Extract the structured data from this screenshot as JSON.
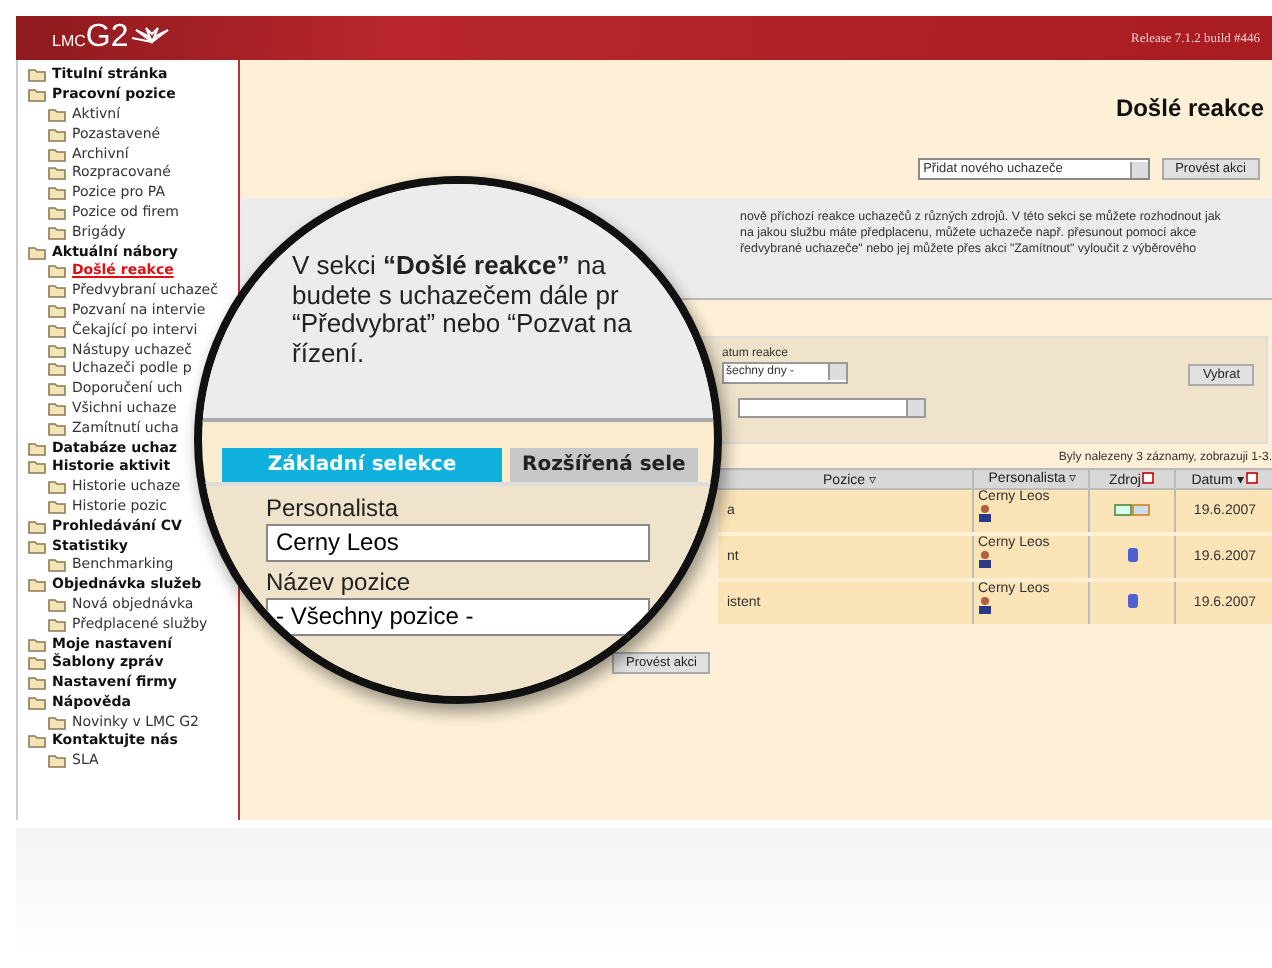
{
  "header": {
    "logo_small": "LMC",
    "logo_big": "G2",
    "release": "Release 7.1.2 build #446"
  },
  "sidebar": {
    "items": [
      {
        "label": "Titulní stránka",
        "selected": false
      },
      {
        "label": "Pracovní pozice",
        "selected": false,
        "children": [
          {
            "label": "Aktivní",
            "selected": false
          },
          {
            "label": "Pozastavené",
            "selected": false
          },
          {
            "label": "Archivní",
            "selected": false
          },
          {
            "label": "Rozpracované",
            "selected": false
          },
          {
            "label": "Pozice pro PA",
            "selected": false
          },
          {
            "label": "Pozice od firem",
            "selected": false
          },
          {
            "label": "Brigády",
            "selected": false
          }
        ]
      },
      {
        "label": "Aktuální nábory",
        "selected": false,
        "children": [
          {
            "label": "Došlé reakce",
            "selected": true
          },
          {
            "label": "Předvybraní uchazeč",
            "selected": false
          },
          {
            "label": "Pozvaní na intervie",
            "selected": false
          },
          {
            "label": "Čekající po intervi",
            "selected": false
          },
          {
            "label": "Nástupy uchazeč",
            "selected": false
          },
          {
            "label": "Uchazeči podle p",
            "selected": false
          },
          {
            "label": "Doporučení uch",
            "selected": false
          },
          {
            "label": "Všichni uchaze",
            "selected": false
          },
          {
            "label": "Zamítnutí ucha",
            "selected": false
          }
        ]
      },
      {
        "label": "Databáze uchaz",
        "selected": false
      },
      {
        "label": "Historie aktivit",
        "selected": false,
        "children": [
          {
            "label": "Historie uchaze",
            "selected": false
          },
          {
            "label": "Historie pozic",
            "selected": false
          }
        ]
      },
      {
        "label": "Prohledávání CV",
        "selected": false
      },
      {
        "label": "Statistiky",
        "selected": false,
        "children": [
          {
            "label": "Benchmarking",
            "selected": false
          }
        ]
      },
      {
        "label": "Objednávka služeb",
        "selected": false,
        "children": [
          {
            "label": "Nová objednávka",
            "selected": false
          },
          {
            "label": "Předplacené služby",
            "selected": false
          }
        ]
      },
      {
        "label": "Moje nastavení",
        "selected": false
      },
      {
        "label": "Šablony zpráv",
        "selected": false
      },
      {
        "label": "Nastavení firmy",
        "selected": false
      },
      {
        "label": "Nápověda",
        "selected": false,
        "children": [
          {
            "label": "Novinky v LMC G2",
            "selected": false
          }
        ]
      },
      {
        "label": "Kontaktujte nás",
        "selected": false,
        "children": [
          {
            "label": "SLA",
            "selected": false
          }
        ]
      }
    ]
  },
  "main": {
    "title": "Došlé reakce",
    "action_select": "Přidat nového uchazeče",
    "action_button": "Provést akci",
    "description_lines": [
      "nově příchozí reakce uchazečů z různých zdrojů. V této sekci se můžete rozhodnout jak",
      "na jakou službu máte předplacenu, můžete uchazeče např. přesunout pomocí akce",
      "ředvybrané uchazeče\" nebo jej můžete přes akci \"Zamítnout\" vyloučit z výběrového"
    ],
    "filter": {
      "date_label": "atum reakce",
      "date_select": "šechny dny -",
      "button": "Vybrat"
    },
    "results": "Byly nalezeny 3 záznamy, zobrazuji 1-3.",
    "table": {
      "columns": [
        "Pozice ▿",
        "Personalista ▿",
        "Zdroj",
        "Datum ▾"
      ],
      "rows": [
        {
          "position": "a",
          "recruiter": "Cerny Leos",
          "kind": "web",
          "date": "19.6.2007"
        },
        {
          "position": "nt",
          "recruiter": "Cerny Leos",
          "kind": "database",
          "date": "19.6.2007"
        },
        {
          "position": "istent",
          "recruiter": "Cerny Leos",
          "kind": "database",
          "date": "19.6.2007"
        }
      ]
    },
    "bottom_button": "Provést akci"
  },
  "magnifier": {
    "text_lines": [
      "V sekci **“Došlé reakce”** na",
      "budete s uchazečem dále pr",
      "“Předvybrat” nebo “Pozvat na",
      "řízení."
    ],
    "tabs": [
      {
        "label": "Základní selekce",
        "selected": true
      },
      {
        "label": "Rozšířená sele",
        "selected": false
      }
    ],
    "fields": [
      {
        "label": "Personalista",
        "value": "Cerny Leos"
      },
      {
        "label": "Název pozice",
        "value": "- Všechny pozice -"
      }
    ]
  }
}
